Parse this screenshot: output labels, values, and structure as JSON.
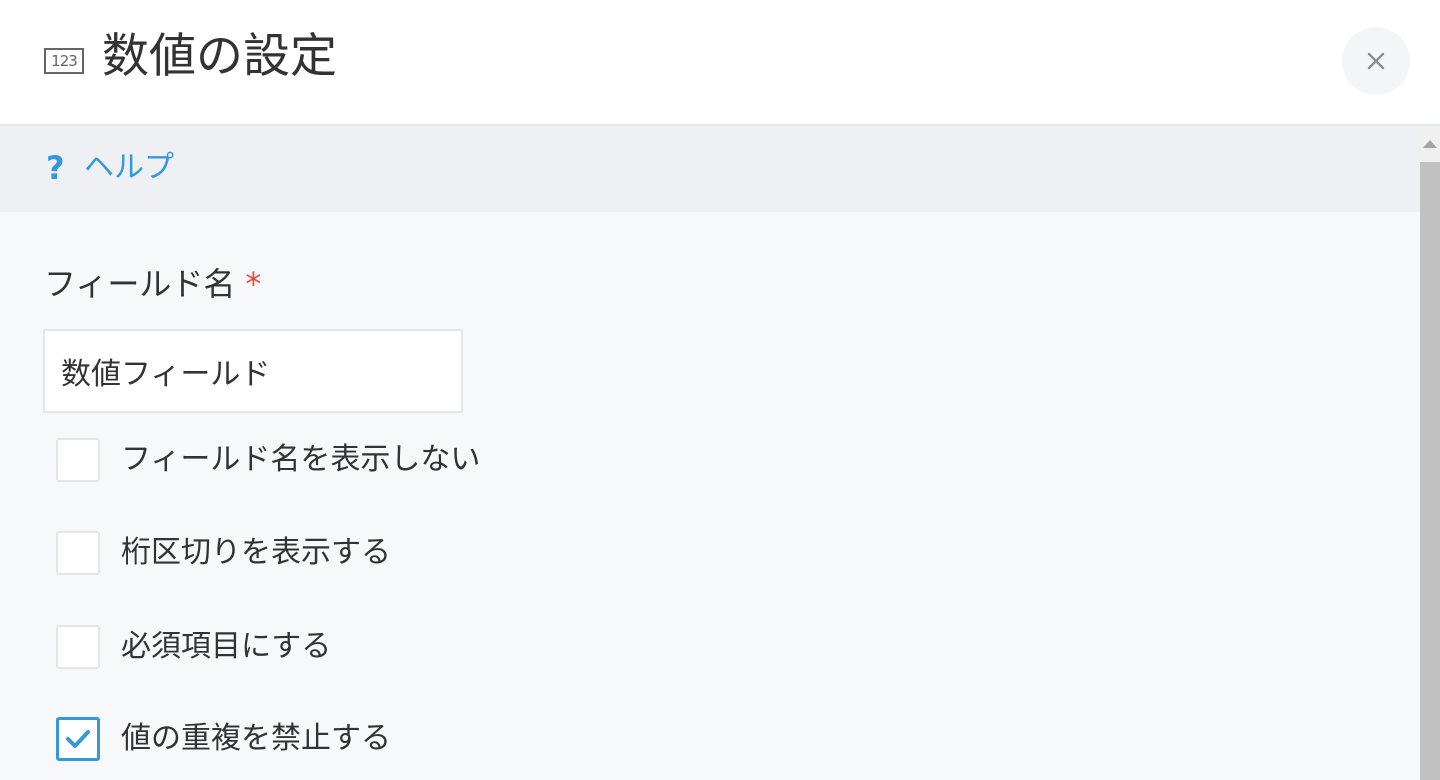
{
  "header": {
    "icon_text": "123",
    "title": "数値の設定",
    "close_symbol": "×"
  },
  "help": {
    "icon": "?",
    "label": "ヘルプ"
  },
  "form": {
    "field_name_label": "フィールド名",
    "required_mark": "*",
    "field_name_value": "数値フィールド",
    "options": [
      {
        "label": "フィールド名を表示しない",
        "checked": false
      },
      {
        "label": "桁区切りを表示する",
        "checked": false
      },
      {
        "label": "必須項目にする",
        "checked": false
      },
      {
        "label": "値の重複を禁止する",
        "checked": true
      }
    ]
  },
  "colors": {
    "accent": "#3498db",
    "required": "#e74c3c",
    "text": "#333333",
    "border": "#e3e7e8"
  }
}
